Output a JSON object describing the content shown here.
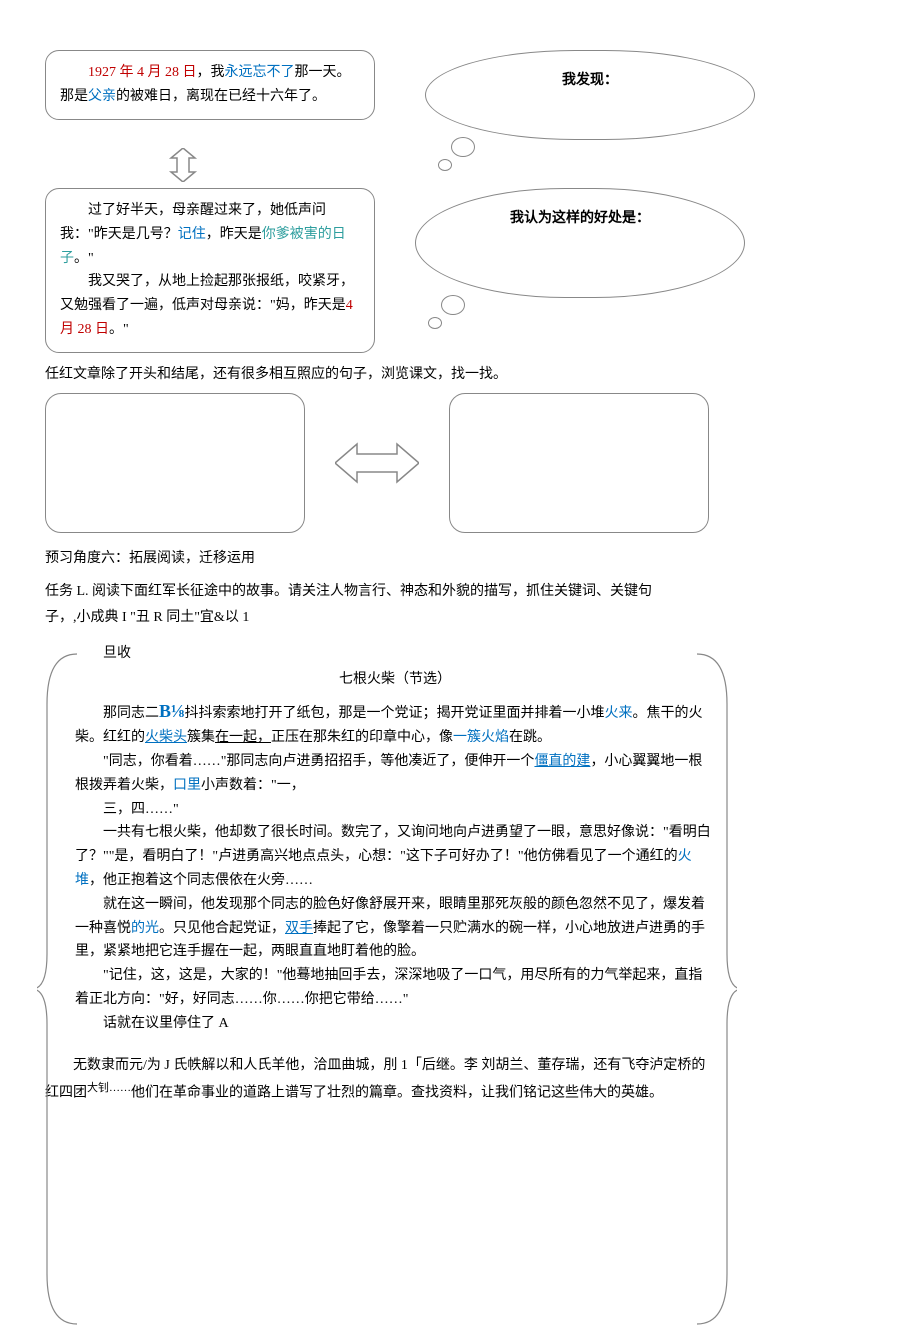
{
  "box1": {
    "line": "1927 年 4 月 28 日，我永远忘不了那一天。那是父亲的被难日，离现在已经十六年了。",
    "seg_red": "1927 年 4 月 28 日",
    "seg_blue1": "永远忘不了",
    "seg_blue2": "父亲",
    "seg_plain_a": "，我",
    "seg_plain_b": "那一天。那是",
    "seg_plain_c": "的被难日，离现在已经十六年了。"
  },
  "thought1": "我发现：",
  "box2": {
    "l1a": "过了好半天，母亲醒过来了，她低声问我：\"昨天是几号？",
    "l1_mem": "记住",
    "l1b": "，昨天是",
    "l1_teal": "你爹被害的日子",
    "l1c": "。\"",
    "l2": "我又哭了，从地上捡起那张报纸，咬紧牙，又勉强看了一遍，低声对母亲说：\"妈，昨天是",
    "l2_red": "4 月 28 日",
    "l2_end": "。\""
  },
  "thought2": "我认为这样的好处是：",
  "instr1": "任红文章除了开头和结尾，还有很多相互照应的句子，浏览课文，找一找。",
  "section6": "预习角度六：拓展阅读，迁移运用",
  "task_l1": "任务 L. 阅读下面红军长征途中的故事。请关注人物言行、神态和外貌的描写，抓住关键词、关键句",
  "task_l2": "子，,小成典 I \"丑 R 同土\"宜&以 1",
  "story": {
    "pre": "旦收",
    "title": "七根火柴（节选）",
    "p1a": "那同志二",
    "p1_b18": "B⅛",
    "p1b": "抖抖索索地打开了纸包，那是一个党证；揭开党证里面并排着一小堆",
    "p1_fire": "火来",
    "p1c": "。焦干的火柴。红红的",
    "p1_head": "火柴头",
    "p1d": "簇集",
    "p1_together": "在一起，",
    "p1e": "正压在那朱红的印章中心，像",
    "p1_flame": "一簇火焰",
    "p1f": "在跳。",
    "p2a": "\"同志，你看着……\"那同志向卢进勇招招手，等他凑近了，便伸开一个",
    "p2_stiff": "僵直的建",
    "p2b": "，小心翼翼地一根根拨弄着火柴，",
    "p2_mouth": "口里",
    "p2c": "小声数着：\"一，",
    "p2d": "三，四……\"",
    "p3a": "一共有七根火柴，他却数了很长时间。数完了，又询问地向卢进勇望了一眼，意思好像说：\"看明白了？\"\"是，看明白了！\"卢进勇高兴地点点头，心想：\"这下子可好办了！\"他仿佛看见了一个通红的",
    "p3_pile": "火堆",
    "p3b": "，他正抱着这个同志偎依在火旁……",
    "p4a": "就在这一瞬间，他发现那个同志的脸色好像舒展开来，眼睛里那死灰般的颜色忽然不见了，爆发着一种喜悦",
    "p4_light": "的光",
    "p4b": "。只见他合起党证，",
    "p4_hands": "双手",
    "p4c": "捧起了它，像擎着一只贮满水的碗一样，小心地放进卢进勇的手里，紧紧地把它连手握在一起，两眼直直地盯着他的脸。",
    "p5": "\"记住，这，这是，大家的！\"他蓦地抽回手去，深深地吸了一口气，用尽所有的力气举起来，直指着正北方向：\"好，好同志……你……你把它带给……\"",
    "p6": "话就在议里停住了 A"
  },
  "closing": {
    "l1a": "无数隶而元/为 J 氏帙解以和人氏羊他，洽皿曲城，刖 1「后继。李    刘胡兰、董存瑞，还有飞夺泸定桥的",
    "l2a": "红四团",
    "l2_insert": "大钊……",
    "l2b": "他们在革命事业的道路上谱写了壮烈的篇章。查找资料，让我们铭记这些伟大的英雄。"
  }
}
